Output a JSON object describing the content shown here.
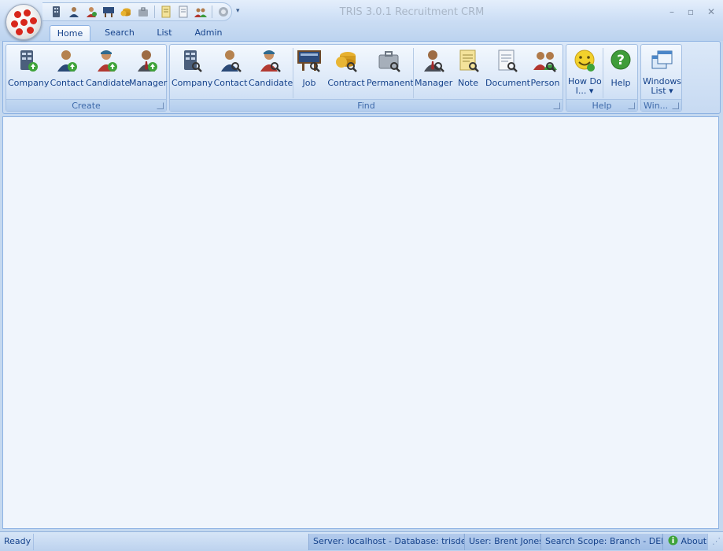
{
  "window": {
    "title": "TRIS 3.0.1 Recruitment CRM",
    "minimize": "–",
    "maximize": "▫",
    "close": "✕"
  },
  "quick_access": {
    "icons": [
      "company-icon",
      "contact-icon",
      "candidate-icon",
      "job-icon",
      "contract-icon",
      "permanent-icon",
      "note-icon",
      "document-icon",
      "person-icon",
      "settings-icon"
    ],
    "more": "▾"
  },
  "tabs": [
    {
      "label": "Home",
      "active": true
    },
    {
      "label": "Search",
      "active": false
    },
    {
      "label": "List",
      "active": false
    },
    {
      "label": "Admin",
      "active": false
    }
  ],
  "ribbon": {
    "create": {
      "label": "Create",
      "buttons": [
        "Company",
        "Contact",
        "Candidate",
        "Manager"
      ]
    },
    "find": {
      "label": "Find",
      "buttons": [
        "Company",
        "Contact",
        "Candidate",
        "Job",
        "Contract",
        "Permanent",
        "Manager",
        "Note",
        "Document",
        "Person"
      ]
    },
    "help": {
      "label": "Help",
      "how_do_line1": "How Do",
      "how_do_line2": "I... ▾",
      "help_button": "Help"
    },
    "windows": {
      "label": "Win...",
      "line1": "Windows",
      "line2": "List ▾"
    }
  },
  "status": {
    "ready": "Ready",
    "server": "Server: localhost - Database: trisdemo",
    "user": "User: Brent Jones",
    "scope": "Search Scope: Branch - DEMO",
    "about": "About"
  },
  "colors": {
    "accent": "#15428b",
    "ribbon_bg": "#dbe8f8",
    "workspace": "#f0f5fc",
    "orb_red": "#d8271c"
  }
}
